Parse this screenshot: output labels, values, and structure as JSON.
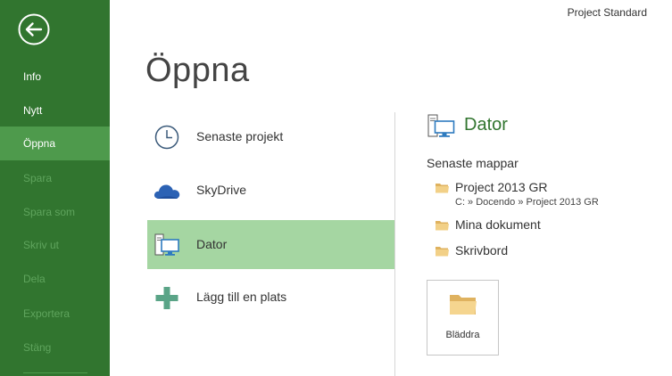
{
  "app": {
    "title": "Project Standard"
  },
  "sidebar": {
    "items": [
      {
        "label": "Info"
      },
      {
        "label": "Nytt"
      },
      {
        "label": "Öppna"
      },
      {
        "label": "Spara"
      },
      {
        "label": "Spara som"
      },
      {
        "label": "Skriv ut"
      },
      {
        "label": "Dela"
      },
      {
        "label": "Exportera"
      },
      {
        "label": "Stäng"
      }
    ],
    "active": "Öppna",
    "colors": {
      "background": "#31752f",
      "active": "#4e9a4c",
      "disabled_text": "#5fa45d"
    }
  },
  "page": {
    "title": "Öppna"
  },
  "places": [
    {
      "label": "Senaste projekt",
      "icon": "clock-icon"
    },
    {
      "label": "SkyDrive",
      "icon": "cloud-icon"
    },
    {
      "label": "Dator",
      "icon": "computer-icon",
      "selected": true
    },
    {
      "label": "Lägg till en plats",
      "icon": "plus-icon"
    }
  ],
  "detail": {
    "title": "Dator",
    "recent_heading": "Senaste mappar",
    "folders": [
      {
        "name": "Project 2013 GR",
        "path": "C: » Docendo » Project 2013 GR"
      },
      {
        "name": "Mina dokument"
      },
      {
        "name": "Skrivbord"
      }
    ],
    "browse_label": "Bläddra"
  }
}
